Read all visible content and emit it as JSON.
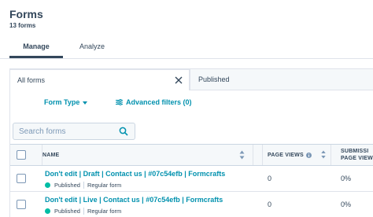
{
  "header": {
    "title": "Forms",
    "subtitle": "13 forms"
  },
  "tabs": [
    {
      "label": "Manage",
      "active": true
    },
    {
      "label": "Analyze",
      "active": false
    }
  ],
  "views": {
    "active_label": "All forms",
    "inactive_label": "Published"
  },
  "filters": {
    "form_type_label": "Form Type",
    "advanced_label": "Advanced filters (0)"
  },
  "search": {
    "placeholder": "Search forms"
  },
  "table": {
    "columns": {
      "name": "NAME",
      "page_views": "PAGE VIEWS",
      "submissions": "SUBMISSI PAGE VIEW"
    },
    "rows": [
      {
        "name": "Don't edit | Draft | Contact us | #07c54efb | Formcrafts",
        "status": "Published",
        "type": "Regular form",
        "page_views": "0",
        "submissions": "0%"
      },
      {
        "name": "Don't edit | Live | Contact us | #07c54efb | Formcrafts",
        "status": "Published",
        "type": "Regular form",
        "page_views": "0",
        "submissions": "0%"
      }
    ]
  },
  "colors": {
    "link": "#0091ae",
    "text": "#33475b",
    "published_dot": "#00bda5",
    "header_bg": "#f5f8fa",
    "border": "#dfe3eb"
  },
  "icons": {
    "close": "close-icon",
    "search": "search-icon",
    "filter": "filter-icon",
    "sort": "sort-icon",
    "info": "info-icon",
    "dropdown": "chevron-down-icon"
  }
}
